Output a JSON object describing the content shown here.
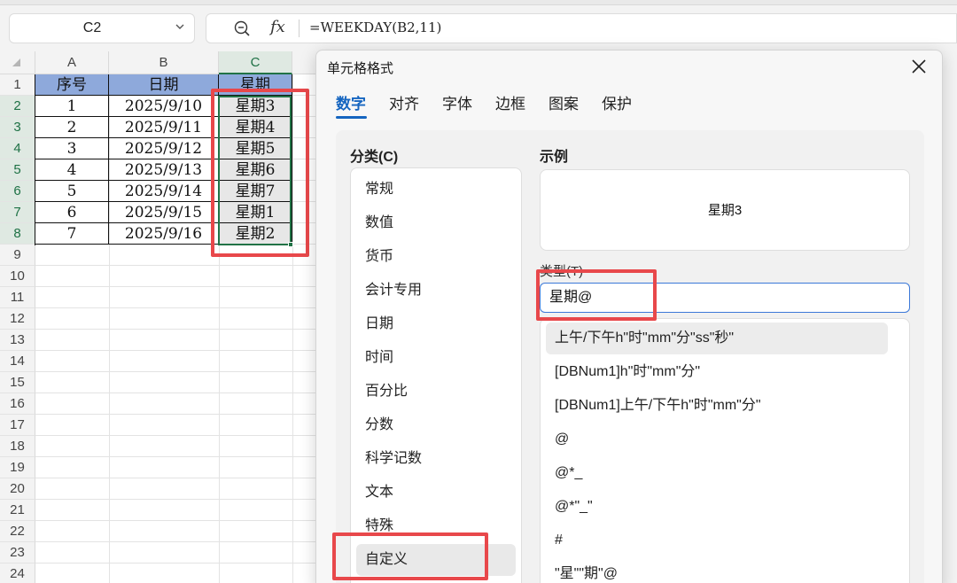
{
  "formula_bar": {
    "name_box": "C2",
    "fx_label": "fx",
    "formula": "=WEEKDAY(B2,11)"
  },
  "sheet": {
    "columns": [
      "A",
      "B",
      "C"
    ],
    "rows": [
      "1",
      "2",
      "3",
      "4",
      "5",
      "6",
      "7",
      "8",
      "9",
      "10",
      "11",
      "12",
      "13",
      "14",
      "15",
      "16",
      "17",
      "18",
      "19",
      "20",
      "21",
      "22",
      "23",
      "24"
    ],
    "header": [
      "序号",
      "日期",
      "星期"
    ],
    "data": [
      [
        "1",
        "2025/9/10",
        "星期3"
      ],
      [
        "2",
        "2025/9/11",
        "星期4"
      ],
      [
        "3",
        "2025/9/12",
        "星期5"
      ],
      [
        "4",
        "2025/9/13",
        "星期6"
      ],
      [
        "5",
        "2025/9/14",
        "星期7"
      ],
      [
        "6",
        "2025/9/15",
        "星期1"
      ],
      [
        "7",
        "2025/9/16",
        "星期2"
      ]
    ],
    "header_fill": "#8ea9db",
    "selection_color": "#217346",
    "highlight_color": "#e8484b"
  },
  "dialog": {
    "title": "单元格格式",
    "tabs": [
      "数字",
      "对齐",
      "字体",
      "边框",
      "图案",
      "保护"
    ],
    "active_tab": "数字",
    "category_label": "分类(C)",
    "categories": [
      "常规",
      "数值",
      "货币",
      "会计专用",
      "日期",
      "时间",
      "百分比",
      "分数",
      "科学记数",
      "文本",
      "特殊",
      "自定义"
    ],
    "selected_category": "自定义",
    "sample_label": "示例",
    "sample_value": "星期3",
    "type_label": "类型(T)",
    "type_value": "星期@",
    "formats": [
      "上午/下午h\"时\"mm\"分\"ss\"秒\"",
      "[DBNum1]h\"时\"mm\"分\"",
      "[DBNum1]上午/下午h\"时\"mm\"分\"",
      "@",
      "@*_",
      "@*\"_\"",
      "#",
      "\"星\"\"期\"@"
    ],
    "accent_color": "#1565c0"
  }
}
